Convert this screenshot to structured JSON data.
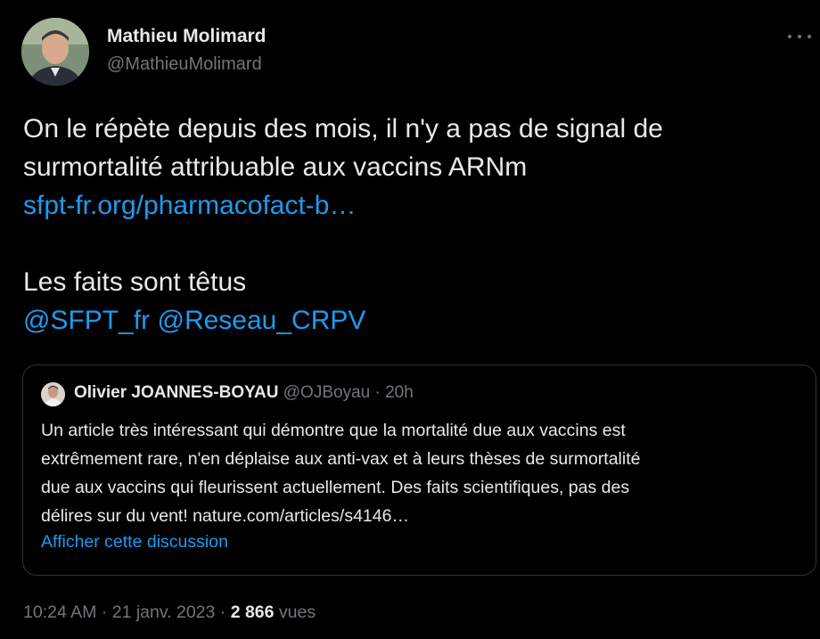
{
  "author": {
    "name": "Mathieu Molimard",
    "handle": "@MathieuMolimard"
  },
  "tweet": {
    "line1": "On le répète depuis des mois, il n'y a pas de signal de",
    "line2": "surmortalité attribuable aux vaccins ARNm",
    "link": "sfpt-fr.org/pharmacofact-b…",
    "line4": "Les faits sont  têtus",
    "mention1": "@SFPT_fr",
    "mention2": "@Reseau_CRPV"
  },
  "quote": {
    "name": "Olivier JOANNES-BOYAU",
    "meta": "@OJBoyau · 20h",
    "lines": [
      "Un article très intéressant qui démontre que la mortalité due aux vaccins est",
      "extrêmement rare, n'en déplaise aux anti-vax et à leurs thèses de surmortalité",
      "due aux vaccins qui fleurissent actuellement. Des faits scientifiques, pas des",
      "délires sur du vent! nature.com/articles/s4146…"
    ],
    "show_thread": "Afficher cette discussion"
  },
  "footer": {
    "time_date": "10:24 AM · 21 janv. 2023 · ",
    "views_count": "2 866",
    "views_label": " vues"
  },
  "icons": {
    "more": "more-horizontal-icon",
    "avatar": "profile-photo",
    "quote_avatar": "profile-photo"
  },
  "colors": {
    "background": "#000000",
    "text": "#e7e9ea",
    "muted": "#71767b",
    "link": "#1d9bf0",
    "border": "#2f3336"
  }
}
